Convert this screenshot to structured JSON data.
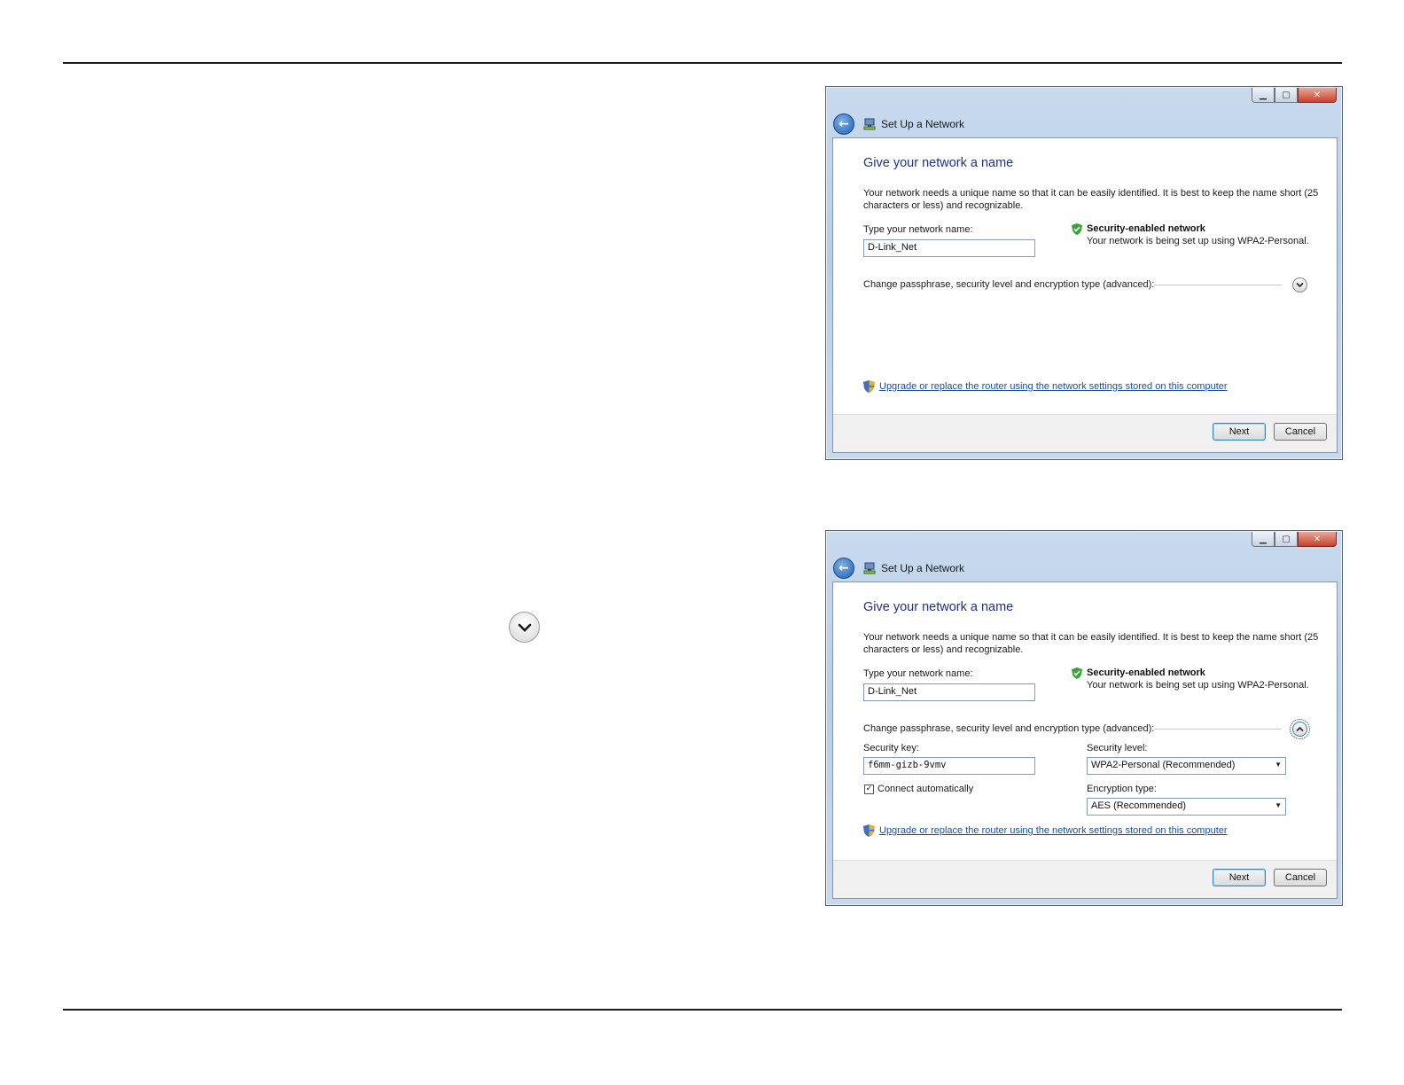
{
  "windows": [
    {
      "title": "Set Up a Network",
      "heading": "Give your network a name",
      "description": "Your network needs a unique name so that it can be easily identified. It is best to keep the name short (25 characters or less) and recognizable.",
      "network_name_label": "Type your network name:",
      "network_name_value": "D-Link_Net",
      "security_title": "Security-enabled network",
      "security_sub": "Your network is being set up using WPA2-Personal.",
      "advanced_label": "Change passphrase, security level and encryption type (advanced):",
      "advanced_expanded": false,
      "upgrade_link": "Upgrade or replace the router using the network settings stored on this computer",
      "next_label": "Next",
      "cancel_label": "Cancel"
    },
    {
      "title": "Set Up a Network",
      "heading": "Give your network a name",
      "description": "Your network needs a unique name so that it can be easily identified. It is best to keep the name short (25 characters or less) and recognizable.",
      "network_name_label": "Type your network name:",
      "network_name_value": "D-Link_Net",
      "security_title": "Security-enabled network",
      "security_sub": "Your network is being set up using WPA2-Personal.",
      "advanced_label": "Change passphrase, security level and encryption type (advanced):",
      "advanced_expanded": true,
      "security_key_label": "Security key:",
      "security_key_value": "f6mm-gizb-9vmv",
      "security_level_label": "Security level:",
      "security_level_value": "WPA2-Personal (Recommended)",
      "connect_auto_label": "Connect automatically",
      "connect_auto_checked": true,
      "encryption_type_label": "Encryption type:",
      "encryption_type_value": "AES (Recommended)",
      "upgrade_link": "Upgrade or replace the router using the network settings stored on this computer",
      "next_label": "Next",
      "cancel_label": "Cancel"
    }
  ],
  "standalone_expand_icon": "chevron-down-icon"
}
